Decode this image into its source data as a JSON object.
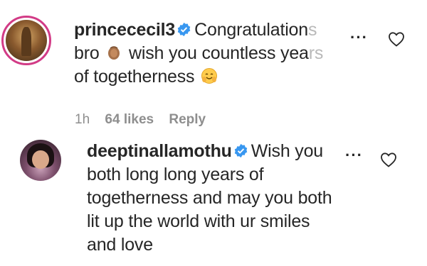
{
  "comments": [
    {
      "username": "princececil3",
      "text_lines": [
        {
          "before": "Congratulation",
          "faded": "s"
        },
        {
          "before": "bro",
          "emoji": "clapping-hands-emoji",
          "after": "wish you countless yea",
          "faded": "rs"
        },
        {
          "before": "of togetherness",
          "emoji": "smiling-face-with-hands-emoji"
        }
      ],
      "time": "1h",
      "likes": "64 likes",
      "reply": "Reply"
    },
    {
      "username": "deeptinallamothu",
      "text_lines": [
        {
          "before": "Wish you"
        },
        {
          "before": "both long long years of"
        },
        {
          "before": "togetherness and may you both"
        },
        {
          "before": "lit up the world with ur smiles"
        },
        {
          "before": "and love"
        }
      ]
    }
  ],
  "icons": {
    "more": "more-options-icon",
    "like": "heart-icon",
    "verified": "verified-badge-icon"
  },
  "colors": {
    "verified": "#3897f0",
    "text": "#262626",
    "meta": "#8e8e8e",
    "story_ring": "#d23b86"
  }
}
